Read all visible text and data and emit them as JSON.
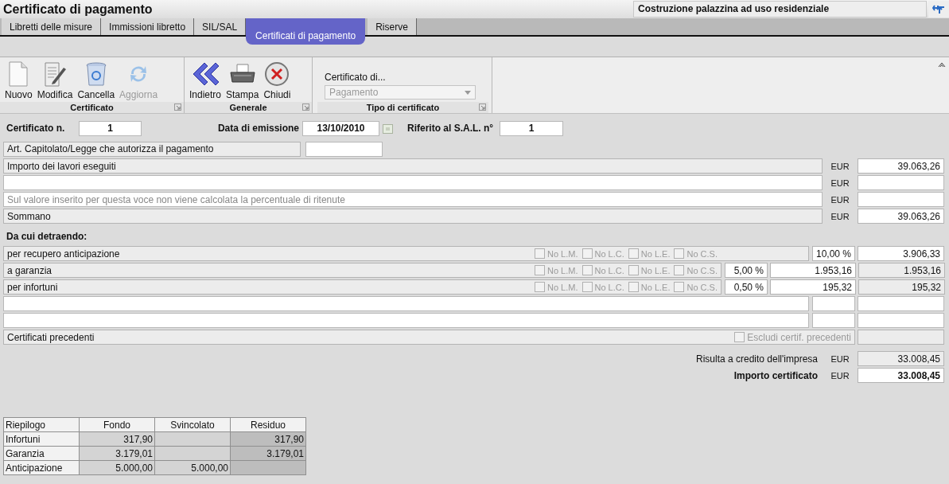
{
  "window": {
    "title": "Certificato di pagamento"
  },
  "project": {
    "name": "Costruzione palazzina ad uso residenziale"
  },
  "tabs": [
    {
      "label": "Libretti delle misure",
      "selected": false
    },
    {
      "label": "Immissioni libretto",
      "selected": false
    },
    {
      "label": "SIL/SAL",
      "selected": false
    },
    {
      "label": "Certificati di pagamento",
      "selected": true
    },
    {
      "label": "Riserve",
      "selected": false
    }
  ],
  "ribbon": {
    "groups": [
      {
        "title": "Certificato",
        "kind": "buttons",
        "buttons": [
          {
            "label": "Nuovo",
            "kind": "new",
            "disabled": false
          },
          {
            "label": "Modifica",
            "kind": "edit",
            "disabled": false
          },
          {
            "label": "Cancella",
            "kind": "delete",
            "disabled": false
          },
          {
            "label": "Aggiorna",
            "kind": "refresh",
            "disabled": true
          }
        ]
      },
      {
        "title": "Generale",
        "kind": "buttons",
        "buttons": [
          {
            "label": "Indietro",
            "kind": "back",
            "disabled": false
          },
          {
            "label": "Stampa",
            "kind": "print",
            "disabled": false
          },
          {
            "label": "Chiudi",
            "kind": "close",
            "disabled": false
          }
        ]
      },
      {
        "title": "Tipo di certificato",
        "kind": "combo",
        "label": "Certificato di...",
        "value": "Pagamento",
        "disabled": true
      }
    ]
  },
  "header": {
    "certificate_number": {
      "label": "Certificato n.",
      "value": "1"
    },
    "issue_date": {
      "label": "Data di emissione",
      "value": "13/10/2010"
    },
    "sal_reference": {
      "label": "Riferito al S.A.L. n°",
      "value": "1"
    }
  },
  "authorization": {
    "label": "Art. Capitolato/Legge che autorizza il pagamento"
  },
  "amounts": [
    {
      "kind": "fixed",
      "label": "Importo dei lavori eseguiti",
      "currency": "EUR",
      "value": "39.063,26"
    },
    {
      "kind": "input",
      "currency": "EUR"
    },
    {
      "kind": "input",
      "placeholder": "Sul valore inserito per questa voce non viene calcolata la percentuale di ritenute",
      "currency": "EUR"
    },
    {
      "kind": "fixed",
      "label": "Sommano",
      "currency": "EUR",
      "value": "39.063,26"
    }
  ],
  "deductions_title": "Da cui detraendo:",
  "deductions": [
    {
      "kind": "advance",
      "label": "per recupero anticipazione",
      "options": [
        {
          "label": "No L.M.",
          "checked": false,
          "disabled": true
        },
        {
          "label": "No L.C.",
          "checked": false,
          "disabled": true
        },
        {
          "label": "No L.E.",
          "checked": false,
          "disabled": true
        },
        {
          "label": "No C.S.",
          "checked": false,
          "disabled": true
        }
      ],
      "percent": "10,00 %",
      "value": "3.906,33"
    },
    {
      "kind": "withholding",
      "label": "a garanzia",
      "options": [
        {
          "label": "No L.M.",
          "checked": false,
          "disabled": true
        },
        {
          "label": "No L.C.",
          "checked": false,
          "disabled": true
        },
        {
          "label": "No L.E.",
          "checked": false,
          "disabled": true
        },
        {
          "label": "No C.S.",
          "checked": false,
          "disabled": true
        }
      ],
      "percent": "5,00 %",
      "amount": "1.953,16",
      "value": "1.953,16"
    },
    {
      "kind": "withholding",
      "label": "per infortuni",
      "options": [
        {
          "label": "No L.M.",
          "checked": false,
          "disabled": true
        },
        {
          "label": "No L.C.",
          "checked": false,
          "disabled": true
        },
        {
          "label": "No L.E.",
          "checked": false,
          "disabled": true
        },
        {
          "label": "No C.S.",
          "checked": false,
          "disabled": true
        }
      ],
      "percent": "0,50 %",
      "amount": "195,32",
      "value": "195,32"
    },
    {
      "kind": "blank"
    },
    {
      "kind": "blank"
    }
  ],
  "previous": {
    "label": "Certificati precedenti",
    "exclude": {
      "label": "Escludi certif. precedenti",
      "checked": false,
      "disabled": true
    }
  },
  "totals": [
    {
      "label": "Risulta a credito dell'impresa",
      "currency": "EUR",
      "value": "33.008,45",
      "emphasis": false
    },
    {
      "label": "Importo certificato",
      "currency": "EUR",
      "value": "33.008,45",
      "emphasis": true
    }
  ],
  "summary": {
    "columns": [
      "Riepilogo",
      "Fondo",
      "Svincolato",
      "Residuo"
    ],
    "rows": [
      {
        "label": "Infortuni",
        "fund": "317,90",
        "residual": "317,90"
      },
      {
        "label": "Garanzia",
        "fund": "3.179,01",
        "residual": "3.179,01"
      },
      {
        "label": "Anticipazione",
        "fund": "5.000,00",
        "released": "5.000,00"
      }
    ]
  }
}
